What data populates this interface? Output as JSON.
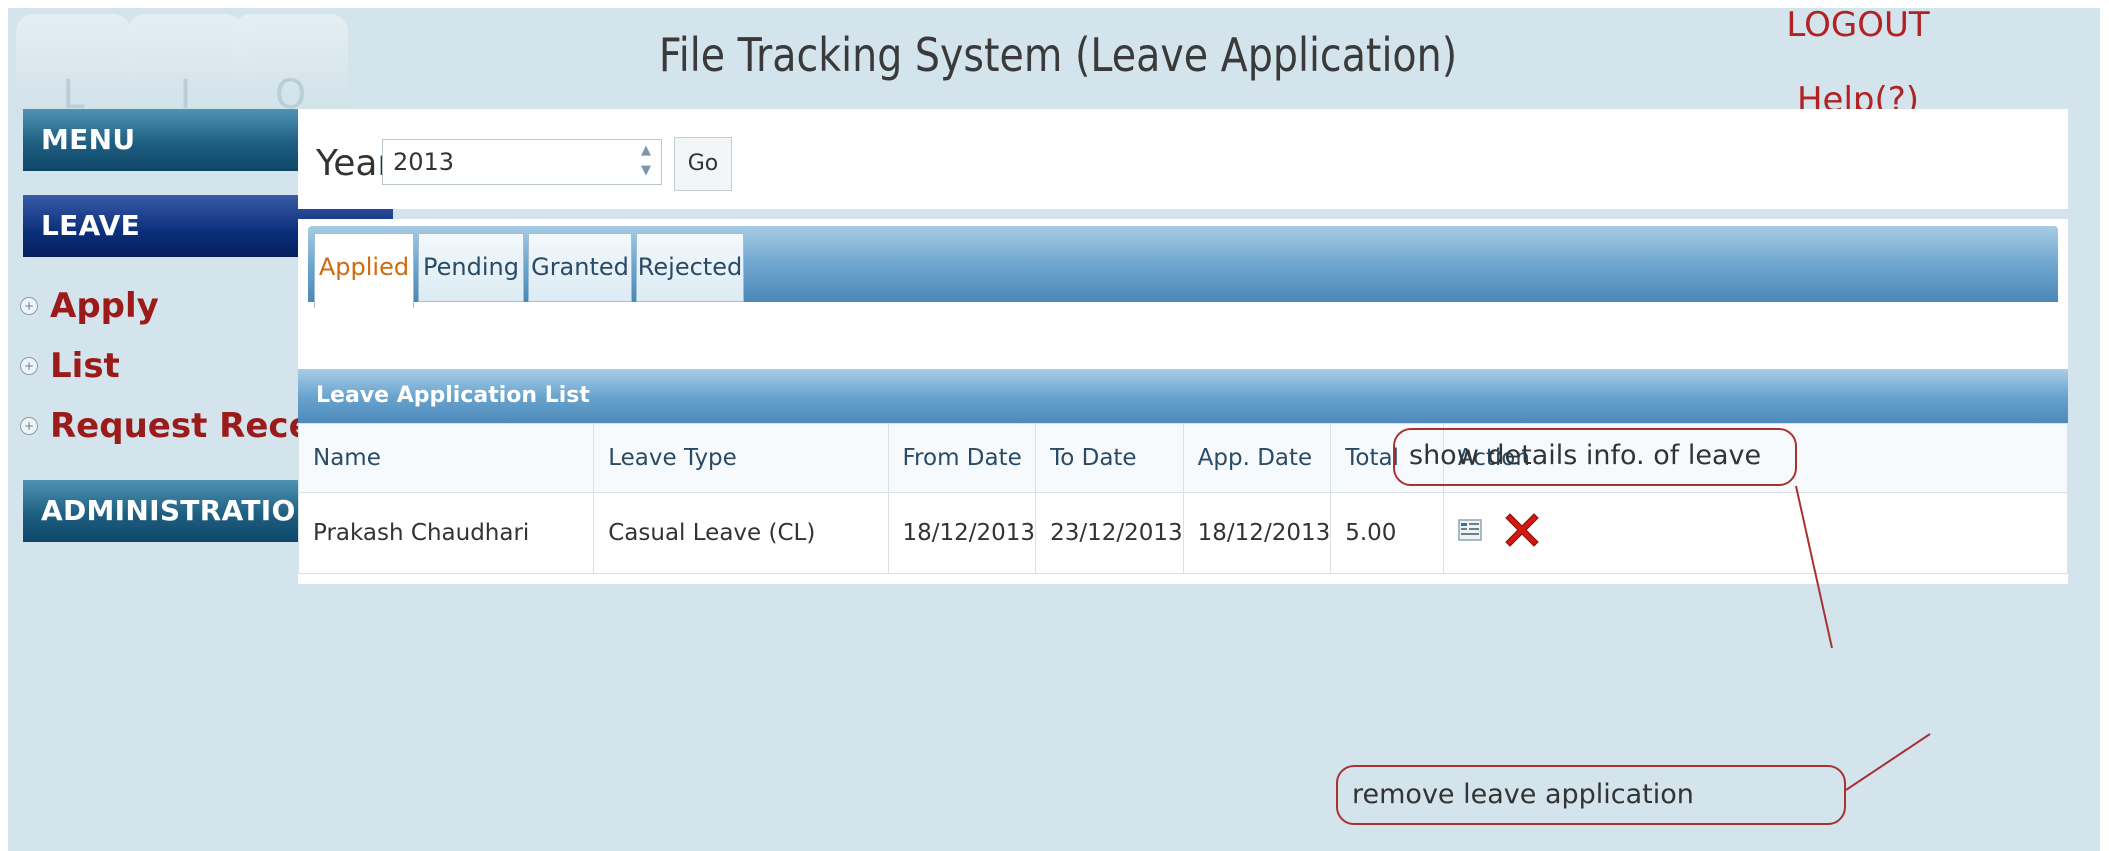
{
  "logo": {
    "glyphs": [
      "L",
      "I",
      "O"
    ]
  },
  "header": {
    "title": "File Tracking System (Leave Application)",
    "logout": "LOGOUT",
    "help": "Help(?)"
  },
  "sidebar": {
    "menu": "MENU",
    "leave": "LEAVE",
    "links": [
      "Apply",
      "List",
      "Request Received"
    ],
    "administration": "ADMINISTRATION"
  },
  "year_filter": {
    "label": "Year:",
    "value": "2013",
    "go": "Go"
  },
  "tabs": [
    "Applied",
    "Pending",
    "Granted",
    "Rejected"
  ],
  "active_tab": "Applied",
  "list": {
    "title": "Leave Application List",
    "columns": [
      "Name",
      "Leave Type",
      "From Date",
      "To Date",
      "App. Date",
      "Total",
      "Action"
    ],
    "rows": [
      {
        "name": "Prakash Chaudhari",
        "leave_type": "Casual Leave (CL)",
        "from_date": "18/12/2013",
        "to_date": "23/12/2013",
        "app_date": "18/12/2013",
        "total": "5.00"
      }
    ]
  },
  "annotations": {
    "details": "show details info. of leave",
    "remove": "remove leave application"
  },
  "colors": {
    "accent_red": "#b22222",
    "tab_active_text": "#d06a10",
    "header_blue": "#4d89ba"
  }
}
